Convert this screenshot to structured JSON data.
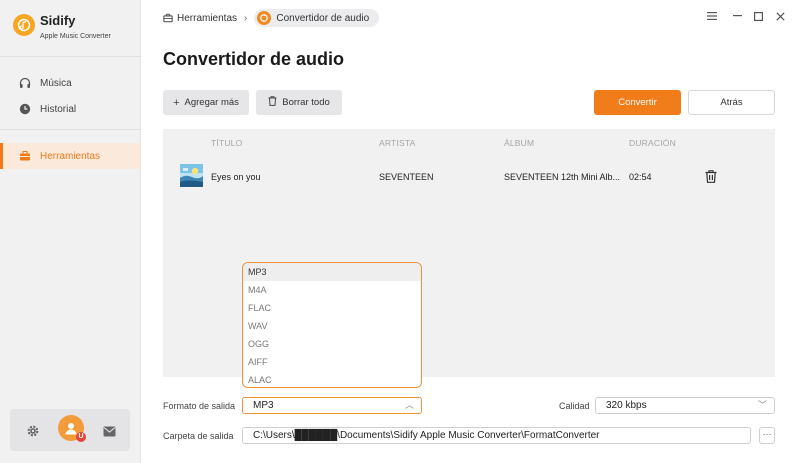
{
  "app": {
    "name": "Sidify",
    "subtitle": "Apple Music Converter",
    "brand_color": "#f07c1a"
  },
  "sidebar": {
    "items": [
      {
        "label": "Música",
        "icon": "headphones-icon",
        "active": false
      },
      {
        "label": "Historial",
        "icon": "clock-icon",
        "active": false
      },
      {
        "label": "Herramientas",
        "icon": "toolbox-icon",
        "active": true
      }
    ],
    "bottom": {
      "settings_icon": "gear-icon",
      "avatar_icon": "user-avatar-icon",
      "badge": "U",
      "mail_icon": "mail-icon"
    }
  },
  "breadcrumb": {
    "root": "Herramientas",
    "current": "Convertidor de audio"
  },
  "window_controls": [
    "menu-icon",
    "minimize-icon",
    "maximize-icon",
    "close-icon"
  ],
  "page": {
    "title": "Convertidor de audio"
  },
  "toolbar": {
    "add_label": "Agregar más",
    "clear_label": "Borrar todo",
    "convert_label": "Convertir",
    "back_label": "Atrás"
  },
  "table": {
    "headers": {
      "title": "TÍTULO",
      "artist": "ARTISTA",
      "album": "ÁLBUM",
      "duration": "DURACIÓN"
    },
    "rows": [
      {
        "title": "Eyes on you",
        "artist": "SEVENTEEN",
        "album": "SEVENTEEN 12th Mini Alb...",
        "duration": "02:54"
      }
    ]
  },
  "format_dropdown": {
    "options": [
      "MP3",
      "M4A",
      "FLAC",
      "WAV",
      "OGG",
      "AIFF",
      "ALAC"
    ],
    "selected": "MP3"
  },
  "output": {
    "format_label": "Formato de salida",
    "format_value": "MP3",
    "quality_label": "Calidad",
    "quality_value": "320 kbps",
    "folder_label": "Carpeta de salida",
    "folder_value": "C:\\Users\\██████\\Documents\\Sidify Apple Music Converter\\FormatConverter",
    "more_label": "···"
  }
}
